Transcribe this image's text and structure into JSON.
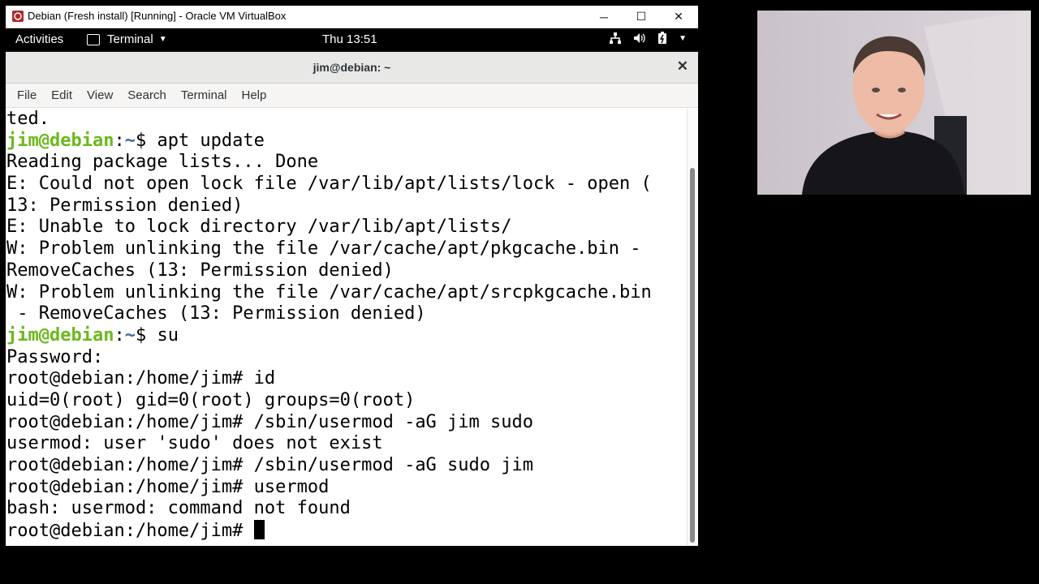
{
  "vbox": {
    "title": "Debian (Fresh install) [Running] - Oracle VM VirtualBox",
    "app_icon": "virtualbox-icon",
    "minimize": "─",
    "maximize": "☐",
    "close": "✕"
  },
  "topbar": {
    "activities": "Activities",
    "app_menu": "Terminal",
    "clock": "Thu 13:51",
    "icons": [
      "network-icon",
      "volume-icon",
      "battery-icon",
      "system-menu-caret-icon"
    ]
  },
  "terminal": {
    "title": "jim@debian: ~",
    "menu": [
      "File",
      "Edit",
      "View",
      "Search",
      "Terminal",
      "Help"
    ],
    "user_color": "#6cb81c",
    "path_color": "#3f64a8",
    "lines": [
      {
        "type": "text",
        "text": "ted."
      },
      {
        "type": "prompt",
        "user": "jim@debian",
        "sep": ":",
        "path": "~",
        "cmd": "$ apt update"
      },
      {
        "type": "text",
        "text": "Reading package lists... Done"
      },
      {
        "type": "text",
        "text": "E: Could not open lock file /var/lib/apt/lists/lock - open ("
      },
      {
        "type": "text",
        "text": "13: Permission denied)"
      },
      {
        "type": "text",
        "text": "E: Unable to lock directory /var/lib/apt/lists/"
      },
      {
        "type": "text",
        "text": "W: Problem unlinking the file /var/cache/apt/pkgcache.bin -"
      },
      {
        "type": "text",
        "text": "RemoveCaches (13: Permission denied)"
      },
      {
        "type": "text",
        "text": "W: Problem unlinking the file /var/cache/apt/srcpkgcache.bin"
      },
      {
        "type": "text",
        "text": " - RemoveCaches (13: Permission denied)"
      },
      {
        "type": "prompt",
        "user": "jim@debian",
        "sep": ":",
        "path": "~",
        "cmd": "$ su"
      },
      {
        "type": "text",
        "text": "Password:"
      },
      {
        "type": "text",
        "text": "root@debian:/home/jim# id"
      },
      {
        "type": "text",
        "text": "uid=0(root) gid=0(root) groups=0(root)"
      },
      {
        "type": "text",
        "text": "root@debian:/home/jim# /sbin/usermod -aG jim sudo"
      },
      {
        "type": "text",
        "text": "usermod: user 'sudo' does not exist"
      },
      {
        "type": "text",
        "text": "root@debian:/home/jim# /sbin/usermod -aG sudo jim"
      },
      {
        "type": "text",
        "text": "root@debian:/home/jim# usermod"
      },
      {
        "type": "text",
        "text": "bash: usermod: command not found"
      },
      {
        "type": "cursor",
        "text": "root@debian:/home/jim# "
      }
    ]
  }
}
